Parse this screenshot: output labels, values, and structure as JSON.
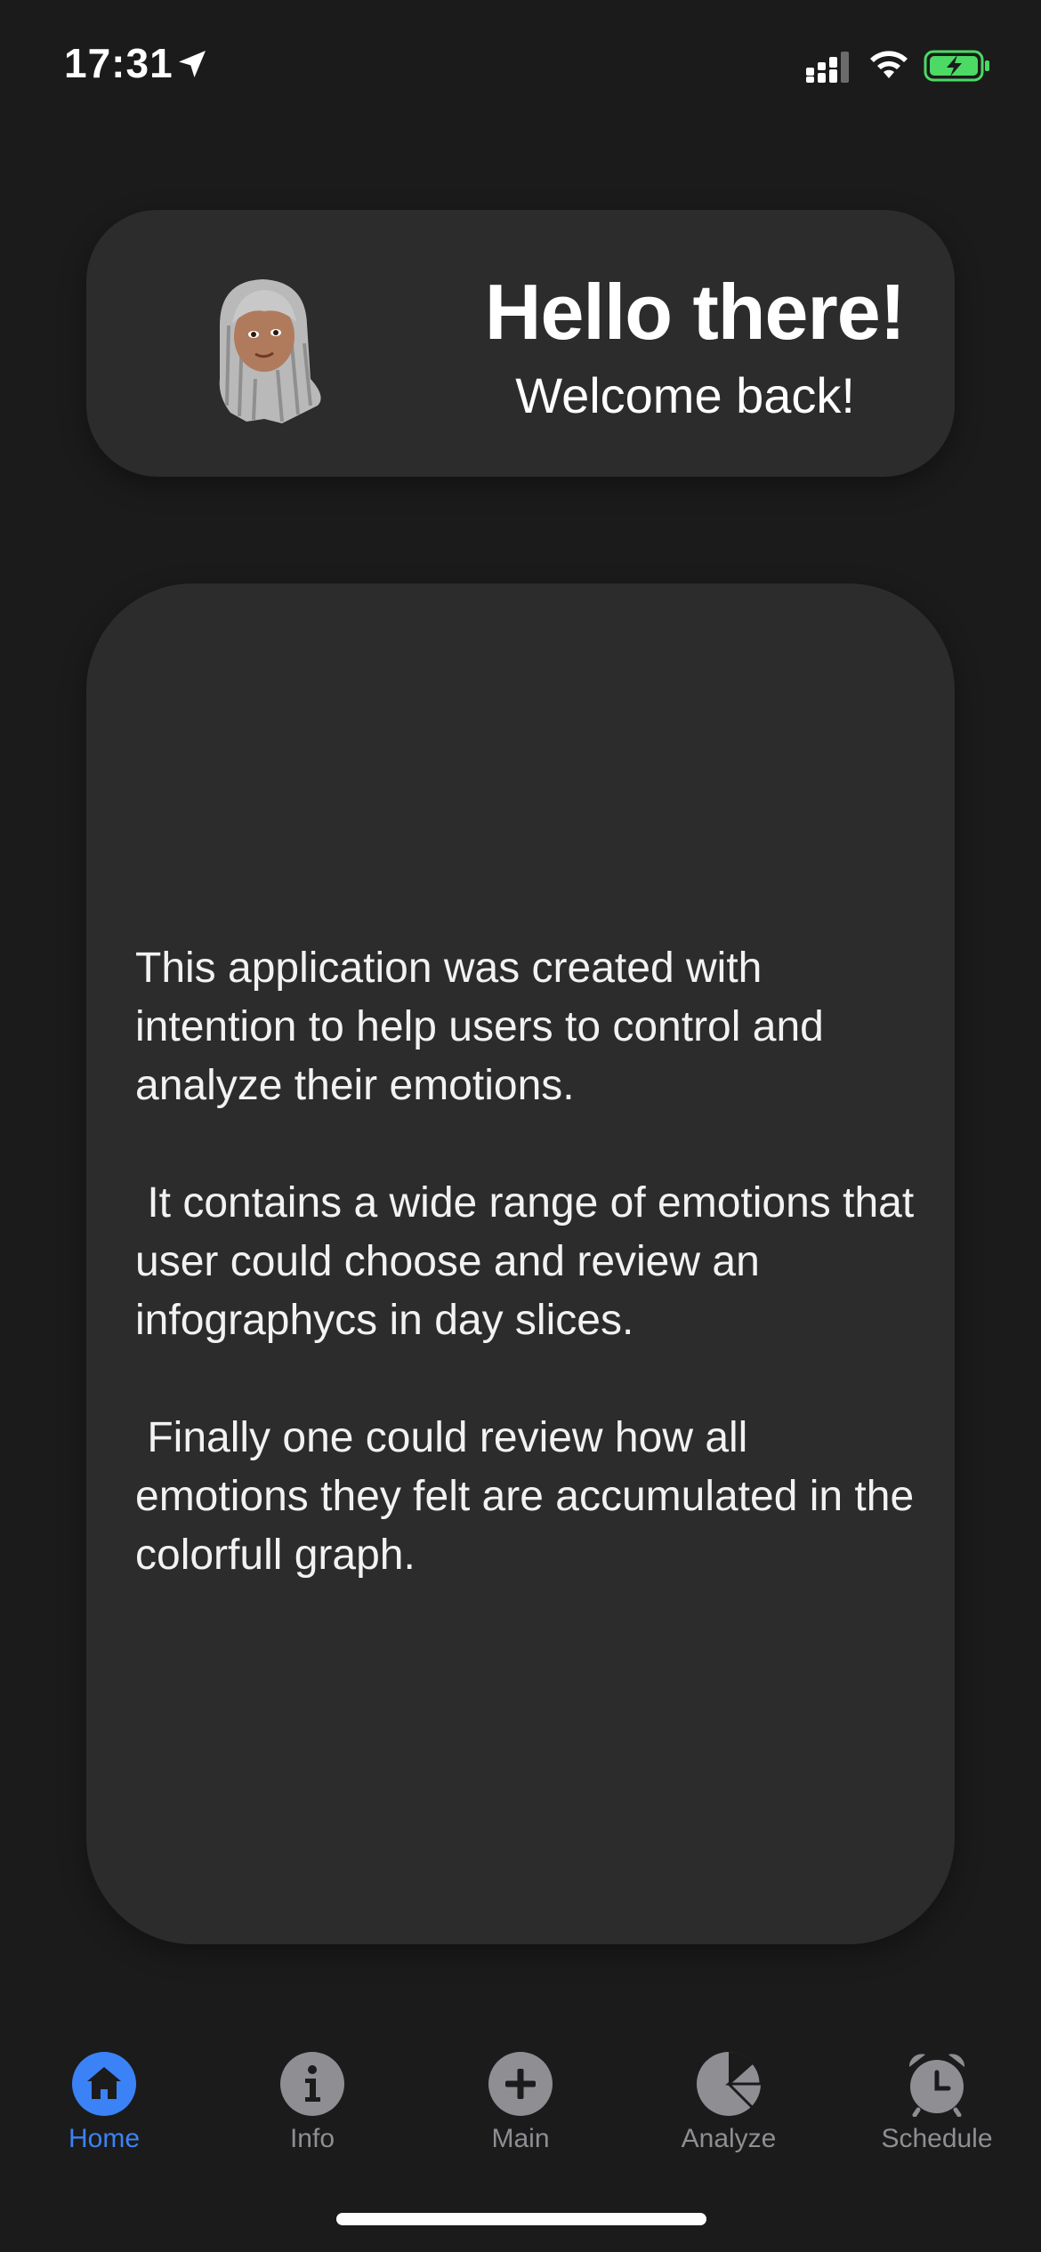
{
  "status_bar": {
    "time": "17:31",
    "icons": [
      "location-arrow-icon",
      "cellular-signal-icon",
      "wifi-icon",
      "battery-charging-icon"
    ]
  },
  "greeting": {
    "title": "Hello there!",
    "subtitle": "Welcome back!",
    "avatar": "memoji-avatar"
  },
  "about": {
    "paragraphs": [
      "This application was created with intention to help users to control and analyze their emotions.",
      " It contains a wide range of emotions that user could choose and review an infographycs in day slices.",
      " Finally one could review how all emotions they felt are accumulated in the colorfull graph."
    ]
  },
  "tabs": [
    {
      "label": "Home",
      "icon": "home-icon",
      "active": true
    },
    {
      "label": "Info",
      "icon": "info-icon",
      "active": false
    },
    {
      "label": "Main",
      "icon": "plus-icon",
      "active": false
    },
    {
      "label": "Analyze",
      "icon": "pie-chart-icon",
      "active": false
    },
    {
      "label": "Schedule",
      "icon": "alarm-clock-icon",
      "active": false
    }
  ],
  "colors": {
    "background": "#1b1b1b",
    "card": "#2c2c2d",
    "accent": "#3b82f6",
    "inactive": "#8e8e93",
    "battery": "#4cd964"
  }
}
